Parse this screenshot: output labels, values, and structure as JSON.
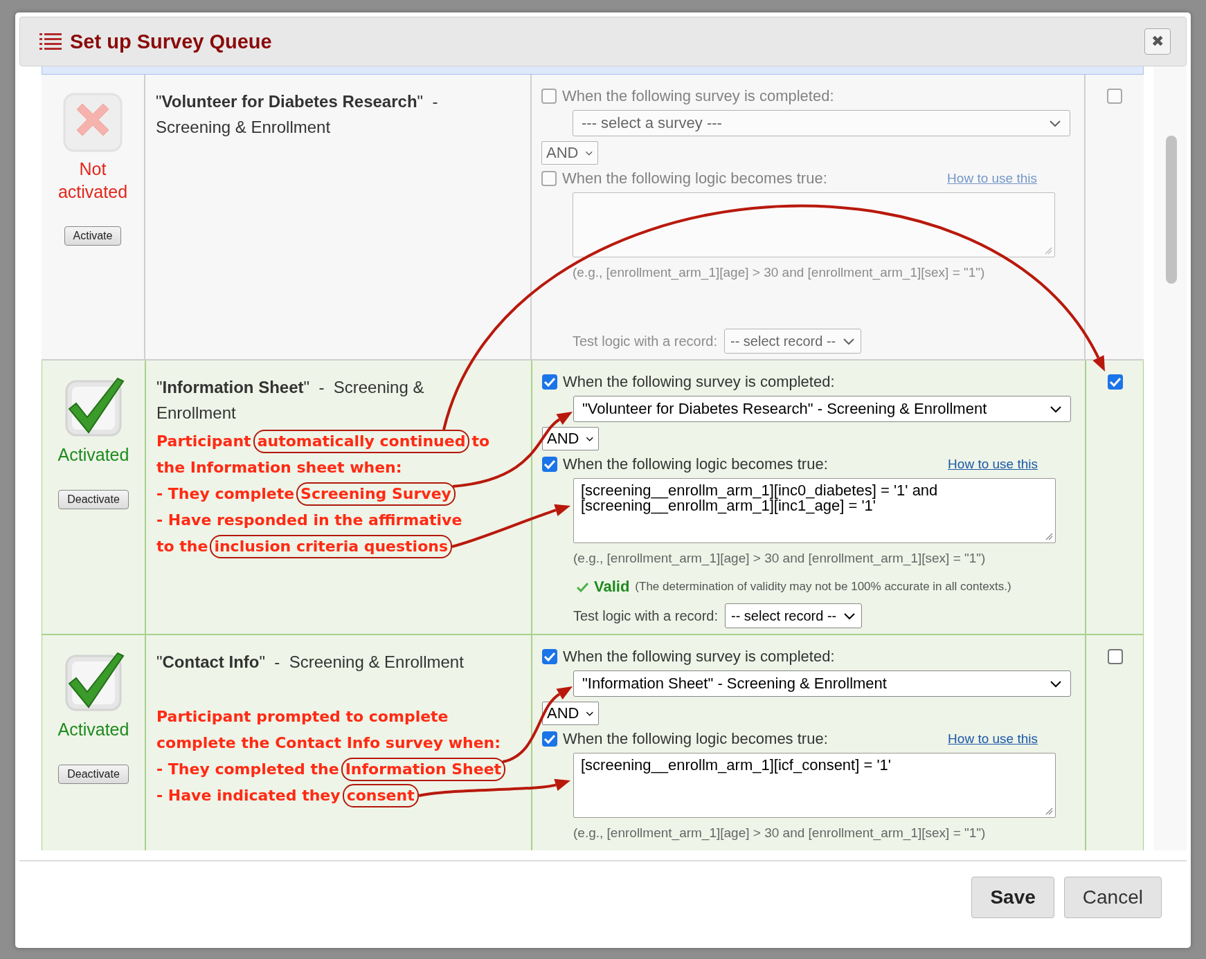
{
  "dialog": {
    "title": "Set up Survey Queue",
    "close_label": "✖"
  },
  "surveys": [
    {
      "title": "\"**Volunteer for Diabetes Research**\"  -  Screening & Enrollment",
      "activated": false,
      "status": "Not activated",
      "toggle_button": "Activate",
      "survey_condition": {
        "checked": false,
        "label": "When the following survey is completed:",
        "select": "--- select a survey ---"
      },
      "operator": "AND",
      "logic_condition": {
        "checked": false,
        "label": "When the following logic becomes true:",
        "link": "How to use this"
      },
      "example": "(e.g., [enrollment_arm_1][age] > 30 and [enrollment_arm_1][sex] = \"1\")",
      "test_label": "Test logic with a record:",
      "test_select": "-- select record --",
      "auto_start": false
    },
    {
      "title": "\"**Information Sheet**\"  -  Screening & Enrollment",
      "activated": true,
      "status": "Activated",
      "toggle_button": "Deactivate",
      "annotation": [
        [
          {
            "text": "Participant",
            "circled": false
          },
          {
            "text": "automatically continued",
            "circled": true
          },
          {
            "text": "to",
            "circled": false
          }
        ],
        [
          {
            "text": "the Information sheet when:",
            "circled": false
          }
        ],
        [
          {
            "text": "- They complete",
            "circled": false
          },
          {
            "text": "Screening Survey",
            "circled": true
          }
        ],
        [
          {
            "text": "- Have responded in the affirmative",
            "circled": false
          }
        ],
        [
          {
            "text": "to the",
            "circled": false
          },
          {
            "text": "inclusion criteria questions",
            "circled": true
          }
        ]
      ],
      "survey_condition": {
        "checked": true,
        "label": "When the following survey is completed:",
        "select": "\"Volunteer for Diabetes Research\" - Screening & Enrollment"
      },
      "operator": "AND",
      "logic_condition": {
        "checked": true,
        "label": "When the following logic becomes true:",
        "link": "How to use this",
        "logic": "[screening__enrollm_arm_1][inc0_diabetes] = '1' and [screening__enrollm_arm_1][inc1_age] = '1'"
      },
      "example": "(e.g., [enrollment_arm_1][age] > 30 and [enrollment_arm_1][sex] = \"1\")",
      "validation": {
        "text": "Valid",
        "note": "(The determination of validity may not be 100% accurate in all contexts.)"
      },
      "test_label": "Test logic with a record:",
      "test_select": "-- select record --",
      "auto_start": true
    },
    {
      "title": "\"**Contact Info**\"  -  Screening & Enrollment",
      "activated": true,
      "status": "Activated",
      "toggle_button": "Deactivate",
      "annotation": [
        [
          {
            "text": "Participant prompted to complete",
            "circled": false
          }
        ],
        [
          {
            "text": "complete the Contact Info survey when:",
            "circled": false
          }
        ],
        [
          {
            "text": "- They completed the",
            "circled": false
          },
          {
            "text": "Information Sheet",
            "circled": true
          }
        ],
        [
          {
            "text": "- Have indicated they",
            "circled": false
          },
          {
            "text": "consent",
            "circled": true
          }
        ]
      ],
      "survey_condition": {
        "checked": true,
        "label": "When the following survey is completed:",
        "select": "\"Information Sheet\" - Screening & Enrollment"
      },
      "operator": "AND",
      "logic_condition": {
        "checked": true,
        "label": "When the following logic becomes true:",
        "link": "How to use this",
        "logic": "[screening__enrollm_arm_1][icf_consent] = '1'"
      },
      "example": "(e.g., [enrollment_arm_1][age] > 30 and [enrollment_arm_1][sex] = \"1\")",
      "auto_start": false
    }
  ],
  "buttons": [
    {
      "label": "Save",
      "primary": true
    },
    {
      "label": "Cancel",
      "primary": false
    }
  ]
}
